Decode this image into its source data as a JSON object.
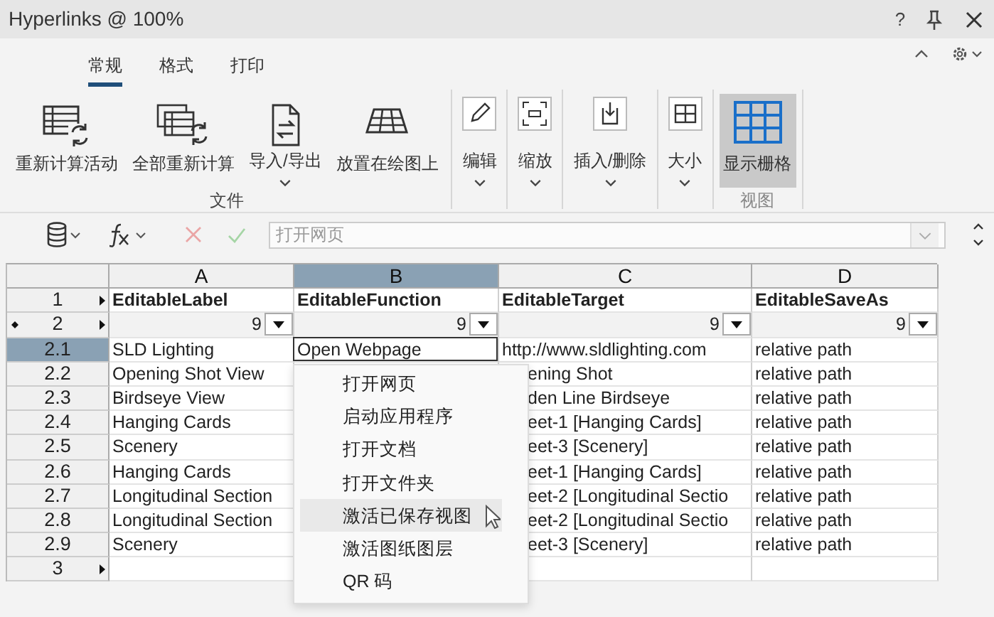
{
  "window": {
    "title": "Hyperlinks @ 100%",
    "help": "?"
  },
  "tabs": [
    {
      "label": "常规",
      "selected": true
    },
    {
      "label": "格式",
      "selected": false
    },
    {
      "label": "打印",
      "selected": false
    }
  ],
  "ribbon_groups": [
    {
      "label": "文件",
      "disabled": false,
      "buttons": [
        {
          "label": "重新计算活动",
          "dropdown": false,
          "pressed": false
        },
        {
          "label": "全部重新计算",
          "dropdown": false,
          "pressed": false
        },
        {
          "label": "导入/导出",
          "dropdown": true,
          "pressed": false
        },
        {
          "label": "放置在绘图上",
          "dropdown": false,
          "pressed": false
        }
      ]
    },
    {
      "buttons": [
        {
          "label": "编辑",
          "dropdown": true,
          "pressed": false
        }
      ]
    },
    {
      "buttons": [
        {
          "label": "缩放",
          "dropdown": true,
          "pressed": false
        }
      ]
    },
    {
      "buttons": [
        {
          "label": "插入/删除",
          "dropdown": true,
          "pressed": false
        }
      ]
    },
    {
      "buttons": [
        {
          "label": "大小",
          "dropdown": true,
          "pressed": false
        }
      ]
    },
    {
      "label": "视图",
      "disabled": true,
      "buttons": [
        {
          "label": "显示栅格",
          "dropdown": false,
          "pressed": true
        }
      ]
    }
  ],
  "formula_bar": {
    "value": "打开网页",
    "disabled": true
  },
  "grid": {
    "columns": [
      {
        "label": "A",
        "selected": false
      },
      {
        "label": "B",
        "selected": true
      },
      {
        "label": "C",
        "selected": false
      },
      {
        "label": "D",
        "selected": false
      }
    ],
    "rows": [
      {
        "kind": "header",
        "label": "1",
        "selected": false,
        "arrow": true,
        "dot": false,
        "cells": {
          "A": "EditableLabel",
          "B": "EditableFunction",
          "C": "EditableTarget",
          "D": "EditableSaveAs"
        }
      },
      {
        "kind": "filter",
        "label": "2",
        "selected": false,
        "arrow": true,
        "dot": true,
        "cells": {
          "A": "9",
          "B": "9",
          "C": "9",
          "D": "9"
        }
      },
      {
        "kind": "data",
        "label": "2.1",
        "selected": true,
        "arrow": false,
        "dot": false,
        "editing": true,
        "cells": {
          "A": "SLD Lighting",
          "B": "Open Webpage",
          "C": "http://www.sldlighting.com",
          "D": "relative path"
        }
      },
      {
        "kind": "data",
        "label": "2.2",
        "selected": false,
        "arrow": false,
        "dot": false,
        "editing": false,
        "cells": {
          "A": "Opening Shot View",
          "C": "ening Shot",
          "D": "relative path"
        }
      },
      {
        "kind": "data",
        "label": "2.3",
        "selected": false,
        "arrow": false,
        "dot": false,
        "editing": false,
        "cells": {
          "A": "Birdseye View",
          "C": "den Line Birdseye",
          "D": "relative path"
        }
      },
      {
        "kind": "data",
        "label": "2.4",
        "selected": false,
        "arrow": false,
        "dot": false,
        "editing": false,
        "cells": {
          "A": "Hanging Cards",
          "C": "eet-1 [Hanging Cards]",
          "D": "relative path"
        }
      },
      {
        "kind": "data",
        "label": "2.5",
        "selected": false,
        "arrow": false,
        "dot": false,
        "editing": false,
        "cells": {
          "A": "Scenery",
          "C": "eet-3 [Scenery]",
          "D": "relative path"
        }
      },
      {
        "kind": "data",
        "label": "2.6",
        "selected": false,
        "arrow": false,
        "dot": false,
        "editing": false,
        "cells": {
          "A": "Hanging Cards",
          "C": "eet-1 [Hanging Cards]",
          "D": "relative path"
        }
      },
      {
        "kind": "data",
        "label": "2.7",
        "selected": false,
        "arrow": false,
        "dot": false,
        "editing": false,
        "cells": {
          "A": "Longitudinal Section",
          "C": "eet-2 [Longitudinal Sectio",
          "D": "relative path"
        }
      },
      {
        "kind": "data",
        "label": "2.8",
        "selected": false,
        "arrow": false,
        "dot": false,
        "editing": false,
        "cells": {
          "A": "Longitudinal Section",
          "C": "eet-2 [Longitudinal Sectio",
          "D": "relative path"
        }
      },
      {
        "kind": "data",
        "label": "2.9",
        "selected": false,
        "arrow": false,
        "dot": false,
        "editing": false,
        "cells": {
          "A": "Scenery",
          "C": "eet-3 [Scenery]",
          "D": "relative path"
        }
      },
      {
        "kind": "data",
        "label": "3",
        "selected": false,
        "arrow": true,
        "dot": false,
        "editing": false
      }
    ]
  },
  "dropdown_menu": {
    "items": [
      {
        "label": "打开网页",
        "highlighted": false
      },
      {
        "label": "启动应用程序",
        "highlighted": false
      },
      {
        "label": "打开文档",
        "highlighted": false
      },
      {
        "label": "打开文件夹",
        "highlighted": false
      },
      {
        "label": "激活已保存视图",
        "highlighted": true
      },
      {
        "label": "激活图纸图层",
        "highlighted": false
      },
      {
        "label": "QR 码",
        "highlighted": false
      }
    ]
  }
}
